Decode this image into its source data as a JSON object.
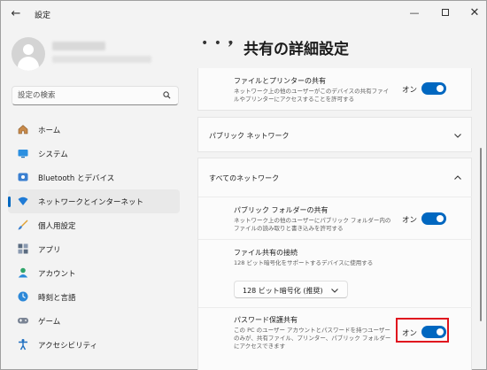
{
  "window": {
    "title": "設定",
    "back_glyph": "←",
    "min_glyph": "—",
    "close_glyph": "✕"
  },
  "search": {
    "placeholder": "設定の検索"
  },
  "sidebar": {
    "items": [
      {
        "label": "ホーム",
        "icon": "home-icon"
      },
      {
        "label": "システム",
        "icon": "system-icon"
      },
      {
        "label": "Bluetooth とデバイス",
        "icon": "bluetooth-icon"
      },
      {
        "label": "ネットワークとインターネット",
        "icon": "network-icon",
        "selected": true
      },
      {
        "label": "個人用設定",
        "icon": "brush-icon"
      },
      {
        "label": "アプリ",
        "icon": "apps-icon"
      },
      {
        "label": "アカウント",
        "icon": "account-icon"
      },
      {
        "label": "時刻と言語",
        "icon": "time-language-icon"
      },
      {
        "label": "ゲーム",
        "icon": "gamepad-icon"
      },
      {
        "label": "アクセシビリティ",
        "icon": "accessibility-icon"
      }
    ]
  },
  "header": {
    "dots": "• • •",
    "chevron": "›",
    "title": "共有の詳細設定"
  },
  "main": {
    "file_printer_sharing": {
      "title": "ファイルとプリンターの共有",
      "desc": "ネットワーク上の他のユーザーがこのデバイスの共有ファイルやプリンターにアクセスすることを許可する",
      "toggle_label": "オン"
    },
    "public_network": {
      "title": "パブリック ネットワーク"
    },
    "all_networks": {
      "title": "すべてのネットワーク"
    },
    "public_folder_sharing": {
      "title": "パブリック フォルダーの共有",
      "desc": "ネットワーク上の他のユーザーにパブリック フォルダー内のファイルの読み取りと書き込みを許可する",
      "toggle_label": "オン"
    },
    "file_sharing_connections": {
      "title": "ファイル共有の接続",
      "desc": "128 ビット暗号化をサポートするデバイスに使用する",
      "dropdown_value": "128 ビット暗号化 (推奨)"
    },
    "password_protected_sharing": {
      "title": "パスワード保護共有",
      "desc": "この PC のユーザー アカウントとパスワードを持つユーザーのみが、共有ファイル、プリンター、パブリック フォルダーにアクセスできます",
      "toggle_label": "オン"
    }
  },
  "colors": {
    "accent": "#0067c0",
    "highlight": "#e0141e"
  }
}
